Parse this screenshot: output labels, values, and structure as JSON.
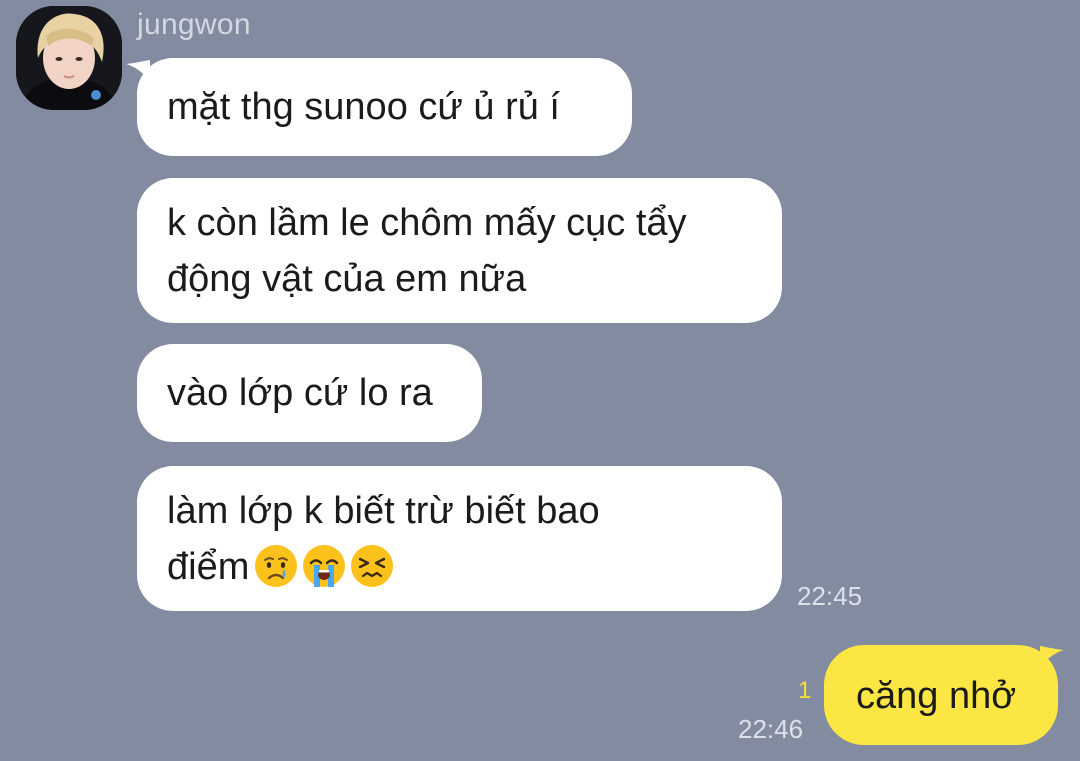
{
  "chat": {
    "sender_name": "jungwon",
    "messages_in": [
      {
        "lines": [
          "mặt thg sunoo cứ ủ rủ í"
        ]
      },
      {
        "lines": [
          "k còn lầm le chôm mấy cục tẩy",
          "động vật của em nữa"
        ]
      },
      {
        "lines": [
          "vào lớp cứ lo ra"
        ]
      },
      {
        "lines": [
          "làm lớp k biết trừ biết bao",
          "điểm"
        ]
      }
    ],
    "last_in_emojis": [
      "crying-face",
      "loudly-crying-face",
      "confounded-face"
    ],
    "time_in": "22:45",
    "message_out": "căng nhở",
    "unread_count": "1",
    "time_out": "22:46"
  },
  "colors": {
    "background": "#828b9f",
    "bubble_in": "#ffffff",
    "bubble_out": "#fbe644",
    "unread": "#f7e03a"
  }
}
